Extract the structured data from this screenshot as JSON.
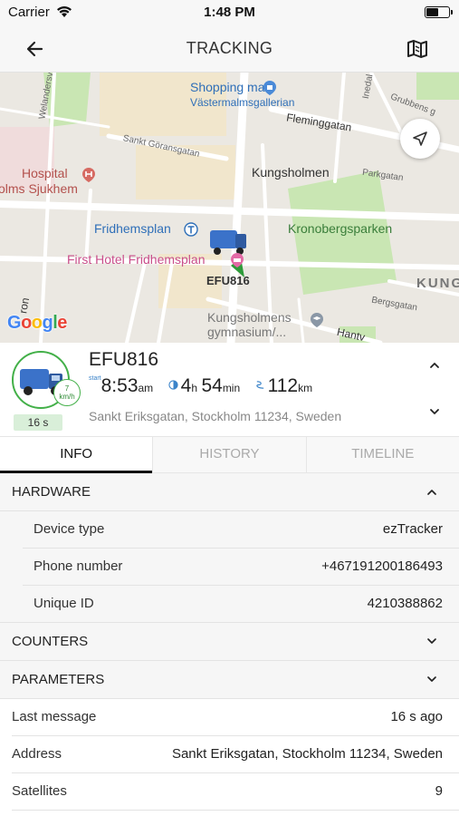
{
  "status_bar": {
    "carrier": "Carrier",
    "time": "1:48 PM",
    "battery_level": 0.55
  },
  "nav": {
    "title": "TRACKING",
    "back_icon": "arrow-left-icon",
    "map_icon": "map-icon"
  },
  "map": {
    "labels": {
      "shopping_mall": "Shopping mall",
      "vastermalmsgallerian": "Västermalmsgallerian",
      "fleminggatan": "Fleminggatan",
      "grubbens_gata": "Grubbens g",
      "sankt_goransgatan": "Sankt Göransgatan",
      "kungsholmen": "Kungsholmen",
      "parkgatan": "Parkgatan",
      "hospital": "Hospital",
      "olms_sjukhem": "olms Sjukhem",
      "fridhemsplan": "Fridhemsplan",
      "kronobergsparken": "Kronobergsparken",
      "first_hotel": "First Hotel Fridhemsplan",
      "vehicle_label": "EFU816",
      "kung": "KUNG",
      "bergsgatan": "Bergsgatan",
      "kungsholmens_gymnasium_1": "Kungsholmens",
      "kungsholmens_gymnasium_2": "gymnasium/...",
      "hantv": "Hantv",
      "ron": "ron",
      "welandersgatan": "Welandersv",
      "inedal": "Inedal",
      "google": "Google"
    }
  },
  "object": {
    "name": "EFU816",
    "speed_value": "7",
    "speed_unit": "km/h",
    "age": "16 s",
    "start_label": "start",
    "start_time": "8:53",
    "start_suffix": "am",
    "duration_hours": "4",
    "duration_h_unit": "h",
    "duration_minutes": "54",
    "duration_min_unit": "min",
    "distance": "112",
    "distance_unit": "km",
    "address": "Sankt Eriksgatan, Stockholm 11234, Sweden"
  },
  "tabs": [
    {
      "label": "INFO",
      "active": true
    },
    {
      "label": "HISTORY",
      "active": false
    },
    {
      "label": "TIMELINE",
      "active": false
    }
  ],
  "info": {
    "hardware": {
      "label": "HARDWARE",
      "rows": [
        {
          "label": "Device type",
          "value": "ezTracker"
        },
        {
          "label": "Phone number",
          "value": "+467191200186493"
        },
        {
          "label": "Unique ID",
          "value": "4210388862"
        }
      ]
    },
    "counters": {
      "label": "COUNTERS"
    },
    "parameters": {
      "label": "PARAMETERS"
    },
    "details": [
      {
        "label": "Last message",
        "value": "16 s ago"
      },
      {
        "label": "Address",
        "value": "Sankt Eriksgatan, Stockholm 11234, Sweden"
      },
      {
        "label": "Satellites",
        "value": "9"
      }
    ]
  },
  "colors": {
    "accent_green": "#43b049",
    "accent_blue": "#3a83c9",
    "map_park": "#c9e6b3"
  }
}
